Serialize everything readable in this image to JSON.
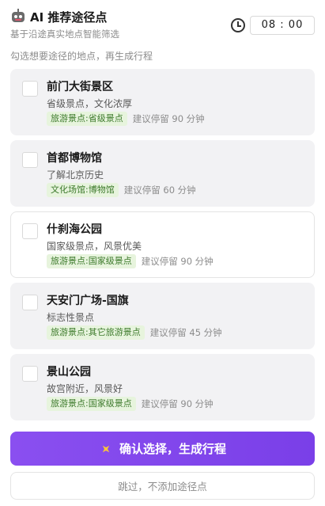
{
  "header": {
    "title": "AI 推荐途径点",
    "subtitle": "基于沿途真实地点智能筛选",
    "time_value": "08 : 00"
  },
  "hint": "勾选想要途径的地点，再生成行程",
  "places": [
    {
      "name": "前门大街景区",
      "desc": "省级景点，文化浓厚",
      "tag": "旅游景点:省级景点",
      "stay": "建议停留 90 分钟",
      "selected": false
    },
    {
      "name": "首都博物馆",
      "desc": "了解北京历史",
      "tag": "文化场馆:博物馆",
      "stay": "建议停留 60 分钟",
      "selected": false
    },
    {
      "name": "什刹海公园",
      "desc": "国家级景点，风景优美",
      "tag": "旅游景点:国家级景点",
      "stay": "建议停留 90 分钟",
      "selected": true
    },
    {
      "name": "天安门广场-国旗",
      "desc": "标志性景点",
      "tag": "旅游景点:其它旅游景点",
      "stay": "建议停留 45 分钟",
      "selected": false
    },
    {
      "name": "景山公园",
      "desc": "故宫附近，风景好",
      "tag": "旅游景点:国家级景点",
      "stay": "建议停留 90 分钟",
      "selected": false
    }
  ],
  "actions": {
    "confirm_label": "确认选择，生成行程",
    "skip_label": "跳过，不添加途径点"
  },
  "colors": {
    "accent": "#8a4ff0",
    "tag_bg": "#e7f4dd",
    "tag_text": "#3d7a2c"
  }
}
